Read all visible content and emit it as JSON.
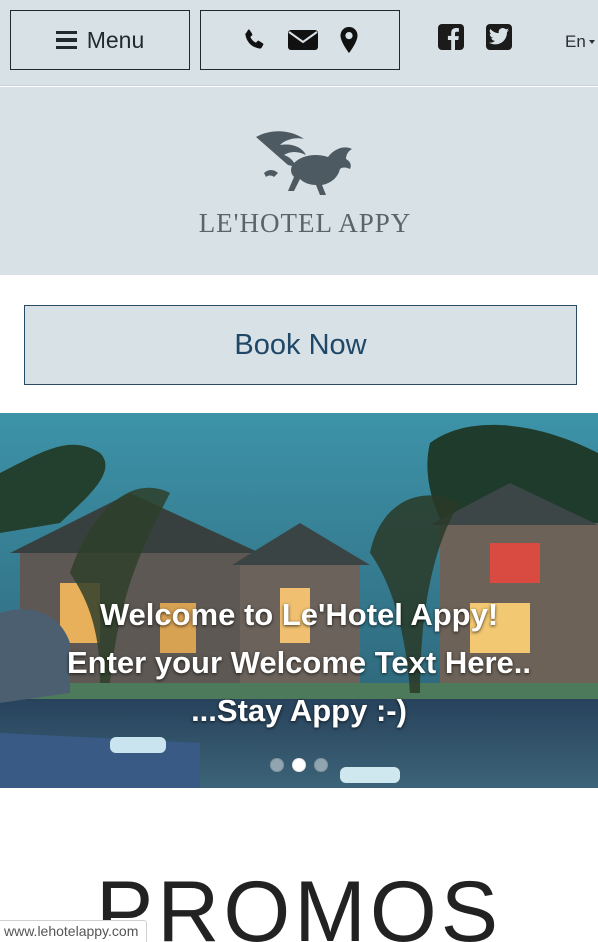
{
  "header": {
    "menu_label": "Menu",
    "icons": [
      "phone-icon",
      "envelope-icon",
      "map-marker-icon",
      "facebook-icon",
      "twitter-icon"
    ],
    "language": "En"
  },
  "logo": {
    "text": "LE'HOTEL APPY"
  },
  "book": {
    "label": "Book Now"
  },
  "hero": {
    "lines": [
      "Welcome to Le'Hotel Appy!",
      "Enter your Welcome Text Here..",
      "...Stay Appy :-)"
    ],
    "slides_count": 3,
    "active_slide": 2
  },
  "promos": {
    "title": "PROMOS"
  },
  "status": {
    "url": "www.lehotelappy.com"
  },
  "colors": {
    "header_bg": "#d8e1e6",
    "book_text": "#1f4767",
    "border_dark": "#1f2a30"
  }
}
